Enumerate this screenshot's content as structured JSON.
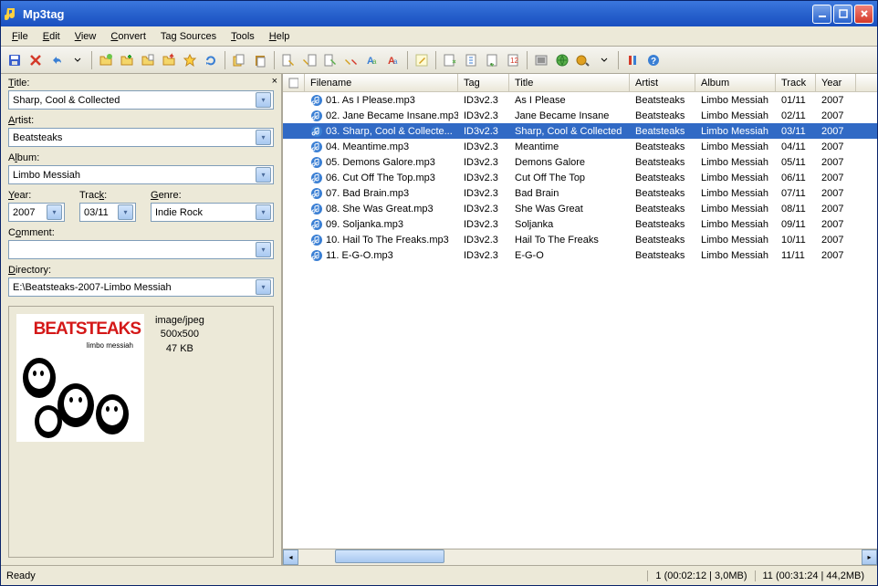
{
  "window": {
    "title": "Mp3tag"
  },
  "menu": {
    "file": "File",
    "edit": "Edit",
    "view": "View",
    "convert": "Convert",
    "tagsources": "Tag Sources",
    "tools": "Tools",
    "help": "Help"
  },
  "fields": {
    "title_label": "Title:",
    "title_value": "Sharp, Cool & Collected",
    "artist_label": "Artist:",
    "artist_value": "Beatsteaks",
    "album_label": "Album:",
    "album_value": "Limbo Messiah",
    "year_label": "Year:",
    "year_value": "2007",
    "track_label": "Track:",
    "track_value": "03/11",
    "genre_label": "Genre:",
    "genre_value": "Indie Rock",
    "comment_label": "Comment:",
    "comment_value": "",
    "directory_label": "Directory:",
    "directory_value": "E:\\Beatsteaks-2007-Limbo Messiah"
  },
  "cover": {
    "band": "BEATSTEAKS",
    "sub": "limbo messiah",
    "mime": "image/jpeg",
    "dims": "500x500",
    "size": "47 KB"
  },
  "columns": {
    "filename": "Filename",
    "tag": "Tag",
    "title": "Title",
    "artist": "Artist",
    "album": "Album",
    "track": "Track",
    "year": "Year"
  },
  "rows": [
    {
      "file": "01. As I Please.mp3",
      "tag": "ID3v2.3",
      "title": "As I Please",
      "artist": "Beatsteaks",
      "album": "Limbo Messiah",
      "track": "01/11",
      "year": "2007",
      "sel": false
    },
    {
      "file": "02. Jane Became Insane.mp3",
      "tag": "ID3v2.3",
      "title": "Jane Became Insane",
      "artist": "Beatsteaks",
      "album": "Limbo Messiah",
      "track": "02/11",
      "year": "2007",
      "sel": false
    },
    {
      "file": "03. Sharp, Cool & Collecte...",
      "tag": "ID3v2.3",
      "title": "Sharp, Cool & Collected",
      "artist": "Beatsteaks",
      "album": "Limbo Messiah",
      "track": "03/11",
      "year": "2007",
      "sel": true
    },
    {
      "file": "04. Meantime.mp3",
      "tag": "ID3v2.3",
      "title": "Meantime",
      "artist": "Beatsteaks",
      "album": "Limbo Messiah",
      "track": "04/11",
      "year": "2007",
      "sel": false
    },
    {
      "file": "05. Demons Galore.mp3",
      "tag": "ID3v2.3",
      "title": "Demons Galore",
      "artist": "Beatsteaks",
      "album": "Limbo Messiah",
      "track": "05/11",
      "year": "2007",
      "sel": false
    },
    {
      "file": "06. Cut Off The Top.mp3",
      "tag": "ID3v2.3",
      "title": "Cut Off The Top",
      "artist": "Beatsteaks",
      "album": "Limbo Messiah",
      "track": "06/11",
      "year": "2007",
      "sel": false
    },
    {
      "file": "07. Bad Brain.mp3",
      "tag": "ID3v2.3",
      "title": "Bad Brain",
      "artist": "Beatsteaks",
      "album": "Limbo Messiah",
      "track": "07/11",
      "year": "2007",
      "sel": false
    },
    {
      "file": "08. She Was Great.mp3",
      "tag": "ID3v2.3",
      "title": "She Was Great",
      "artist": "Beatsteaks",
      "album": "Limbo Messiah",
      "track": "08/11",
      "year": "2007",
      "sel": false
    },
    {
      "file": "09. Soljanka.mp3",
      "tag": "ID3v2.3",
      "title": "Soljanka",
      "artist": "Beatsteaks",
      "album": "Limbo Messiah",
      "track": "09/11",
      "year": "2007",
      "sel": false
    },
    {
      "file": "10. Hail To The Freaks.mp3",
      "tag": "ID3v2.3",
      "title": "Hail To The Freaks",
      "artist": "Beatsteaks",
      "album": "Limbo Messiah",
      "track": "10/11",
      "year": "2007",
      "sel": false
    },
    {
      "file": "11. E-G-O.mp3",
      "tag": "ID3v2.3",
      "title": "E-G-O",
      "artist": "Beatsteaks",
      "album": "Limbo Messiah",
      "track": "11/11",
      "year": "2007",
      "sel": false
    }
  ],
  "status": {
    "ready": "Ready",
    "seg1": "1 (00:02:12 | 3,0MB)",
    "seg2": "11 (00:31:24 | 44,2MB)"
  }
}
